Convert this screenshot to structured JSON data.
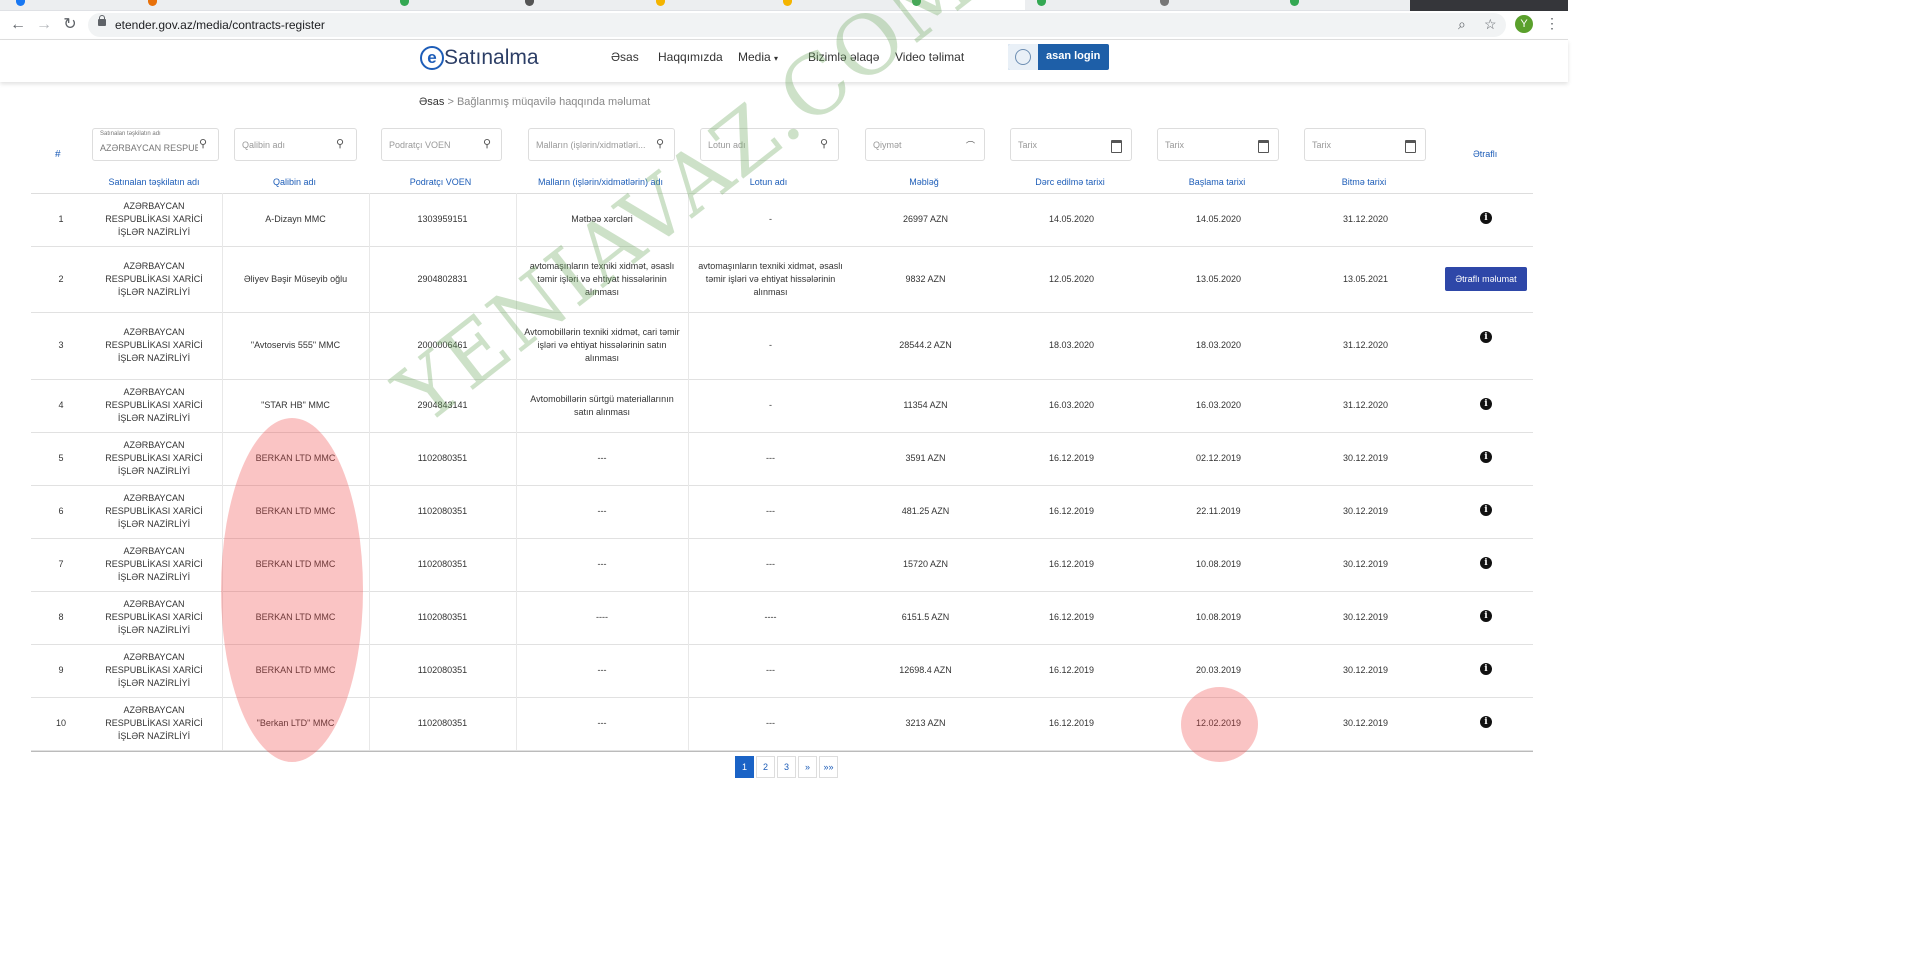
{
  "browser": {
    "url": "etender.gov.az/media/contracts-register",
    "profile_initial": "Y"
  },
  "site": {
    "logo_letter": "e",
    "logo_text": "Satınalma",
    "nav": [
      "Əsas",
      "Haqqımızda",
      "Media",
      "Bizimlə əlaqə",
      "Video təlimat"
    ],
    "login_label": "asan login"
  },
  "breadcrumb": {
    "home": "Əsas",
    "separator": ">",
    "current": "Bağlanmış müqavilə haqqında məlumat"
  },
  "filters": {
    "hash": "#",
    "org_label": "Satınalan təşkilatın adı",
    "org_value": "AZƏRBAYCAN RESPUBLİ",
    "template_ph": "Qalibin adı",
    "voen_ph": "Podratçı VOEN",
    "goods_ph": "Malların (işlərin/xidmətləri...",
    "lot_ph": "Lotun adı",
    "price_ph": "Qiymət",
    "date1_ph": "Tarix",
    "date2_ph": "Tarix",
    "date3_ph": "Tarix",
    "more": "Ətraflı"
  },
  "columns": [
    "Satınalan təşkilatın adı",
    "Qalibin adı",
    "Podratçı VOEN",
    "Malların (işlərin/xidmətlərin) adı",
    "Lotun adı",
    "Məbləğ",
    "Dərc edilmə tarixi",
    "Başlama tarixi",
    "Bitmə tarixi"
  ],
  "rows": [
    {
      "n": "1",
      "org": "AZƏRBAYCAN RESPUBLİKASI XARİCİ İŞLƏR NAZİRLİYİ",
      "winner": "A-Dizayn MMC",
      "voen": "1303959151",
      "goods": "Mətbəə xərcləri",
      "lot": "-",
      "amount": "26997 AZN",
      "published": "14.05.2020",
      "start": "14.05.2020",
      "end": "31.12.2020"
    },
    {
      "n": "2",
      "org": "AZƏRBAYCAN RESPUBLİKASI XARİCİ İŞLƏR NAZİRLİYİ",
      "winner": "Əliyev Bəşir Müseyib oğlu",
      "voen": "2904802831",
      "goods": "avtomaşınların texniki xidmət, əsaslı təmir işləri və ehtiyat hissələrinin alınması",
      "lot": "avtomaşınların texniki xidmət, əsaslı təmir işləri və ehtiyat hissələrinin alınması",
      "amount": "9832 AZN",
      "published": "12.05.2020",
      "start": "13.05.2020",
      "end": "13.05.2021",
      "button": "Ətraflı məlumat"
    },
    {
      "n": "3",
      "org": "AZƏRBAYCAN RESPUBLİKASI XARİCİ İŞLƏR NAZİRLİYİ",
      "winner": "\"Avtoservis 555\" MMC",
      "voen": "2000006461",
      "goods": "Avtomobillərin texniki xidmət, cari təmir işləri və ehtiyat hissələrinin satın alınması",
      "lot": "-",
      "amount": "28544.2 AZN",
      "published": "18.03.2020",
      "start": "18.03.2020",
      "end": "31.12.2020"
    },
    {
      "n": "4",
      "org": "AZƏRBAYCAN RESPUBLİKASI XARİCİ İŞLƏR NAZİRLİYİ",
      "winner": "\"STAR HB\" MMC",
      "voen": "2904843141",
      "goods": "Avtomobillərin sürtgü materiallarının satın alınması",
      "lot": "-",
      "amount": "11354 AZN",
      "published": "16.03.2020",
      "start": "16.03.2020",
      "end": "31.12.2020"
    },
    {
      "n": "5",
      "org": "AZƏRBAYCAN RESPUBLİKASI XARİCİ İŞLƏR NAZİRLİYİ",
      "winner": "BERKAN LTD MMC",
      "voen": "1102080351",
      "goods": "---",
      "lot": "---",
      "amount": "3591 AZN",
      "published": "16.12.2019",
      "start": "02.12.2019",
      "end": "30.12.2019"
    },
    {
      "n": "6",
      "org": "AZƏRBAYCAN RESPUBLİKASI XARİCİ İŞLƏR NAZİRLİYİ",
      "winner": "BERKAN LTD MMC",
      "voen": "1102080351",
      "goods": "---",
      "lot": "---",
      "amount": "481.25 AZN",
      "published": "16.12.2019",
      "start": "22.11.2019",
      "end": "30.12.2019"
    },
    {
      "n": "7",
      "org": "AZƏRBAYCAN RESPUBLİKASI XARİCİ İŞLƏR NAZİRLİYİ",
      "winner": "BERKAN LTD MMC",
      "voen": "1102080351",
      "goods": "---",
      "lot": "---",
      "amount": "15720 AZN",
      "published": "16.12.2019",
      "start": "10.08.2019",
      "end": "30.12.2019"
    },
    {
      "n": "8",
      "org": "AZƏRBAYCAN RESPUBLİKASI XARİCİ İŞLƏR NAZİRLİYİ",
      "winner": "BERKAN LTD MMC",
      "voen": "1102080351",
      "goods": "----",
      "lot": "----",
      "amount": "6151.5 AZN",
      "published": "16.12.2019",
      "start": "10.08.2019",
      "end": "30.12.2019"
    },
    {
      "n": "9",
      "org": "AZƏRBAYCAN RESPUBLİKASI XARİCİ İŞLƏR NAZİRLİYİ",
      "winner": "BERKAN LTD MMC",
      "voen": "1102080351",
      "goods": "---",
      "lot": "---",
      "amount": "12698.4 AZN",
      "published": "16.12.2019",
      "start": "20.03.2019",
      "end": "30.12.2019"
    },
    {
      "n": "10",
      "org": "AZƏRBAYCAN RESPUBLİKASI XARİCİ İŞLƏR NAZİRLİYİ",
      "winner": "\"Berkan LTD\" MMC",
      "voen": "1102080351",
      "goods": "---",
      "lot": "---",
      "amount": "3213 AZN",
      "published": "16.12.2019",
      "start": "12.02.2019",
      "end": "30.12.2019"
    }
  ],
  "pagination": [
    "1",
    "2",
    "3",
    "»",
    "»»"
  ],
  "watermark": "YENIAVAZ.COM"
}
